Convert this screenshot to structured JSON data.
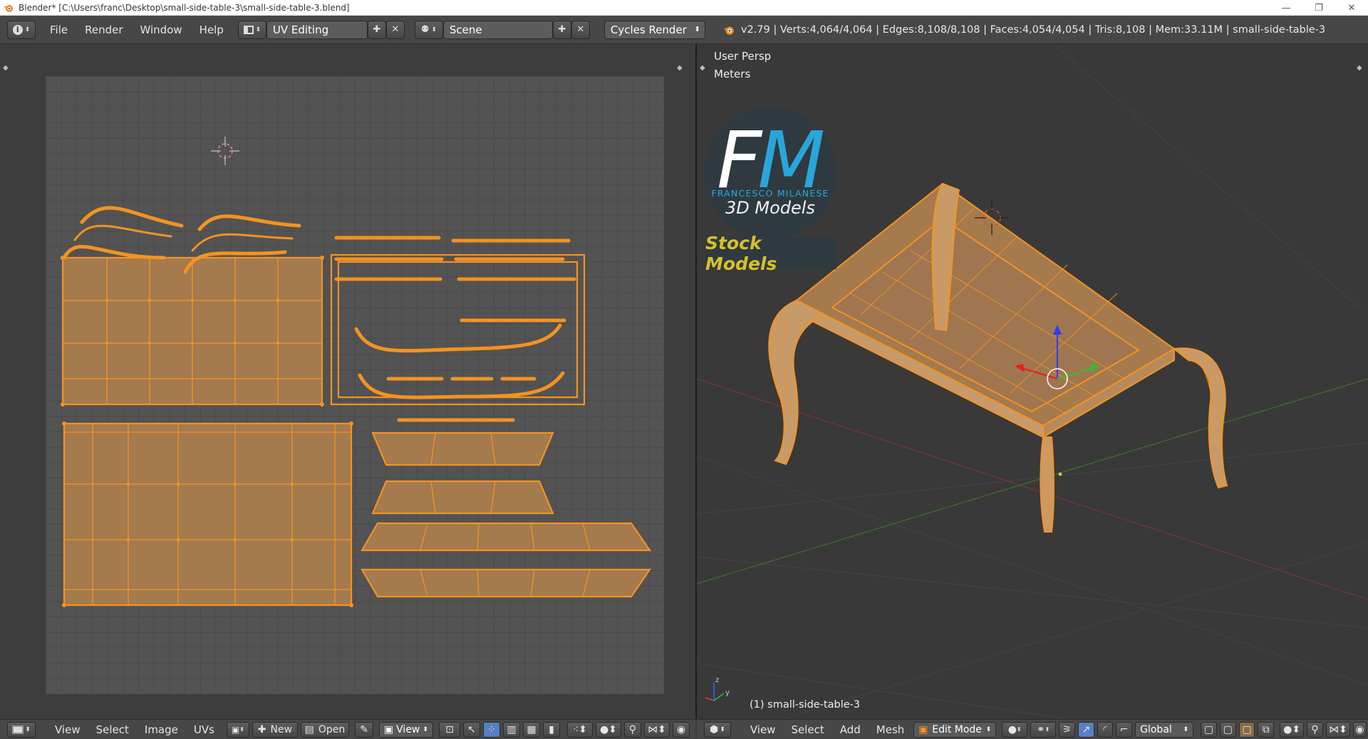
{
  "window": {
    "title": "Blender* [C:\\Users\\franc\\Desktop\\small-side-table-3\\small-side-table-3.blend]",
    "minimize": "—",
    "restore": "❐",
    "close": "✕"
  },
  "menu": {
    "items": [
      "File",
      "Render",
      "Window",
      "Help"
    ],
    "layout": "UV Editing",
    "scene": "Scene",
    "engine": "Cycles Render",
    "stats": "v2.79 | Verts:4,064/4,064 | Edges:8,108/8,108 | Faces:4,054/4,054 | Tris:8,108 | Mem:33.11M | small-side-table-3"
  },
  "uv_editor": {
    "footer": {
      "view": "View",
      "select": "Select",
      "image": "Image",
      "uvs": "UVs",
      "new": "New",
      "open": "Open",
      "view2": "View"
    }
  },
  "viewport": {
    "persp_label": "User Persp",
    "units_label": "Meters",
    "object_label": "(1) small-side-table-3",
    "logo": {
      "letter_f": "F",
      "letter_m": "M",
      "name": "FRANCESCO MILANESE",
      "sub": "3D Models",
      "stock": "Stock Models"
    },
    "footer": {
      "view": "View",
      "select": "Select",
      "add": "Add",
      "mesh": "Mesh",
      "mode": "Edit Mode",
      "orientation": "Global"
    }
  },
  "colors": {
    "accent_orange": "#f39322",
    "uv_fill": "#a57a4d",
    "logo_blue": "#29a6d9",
    "logo_gold": "#d6c12a"
  }
}
